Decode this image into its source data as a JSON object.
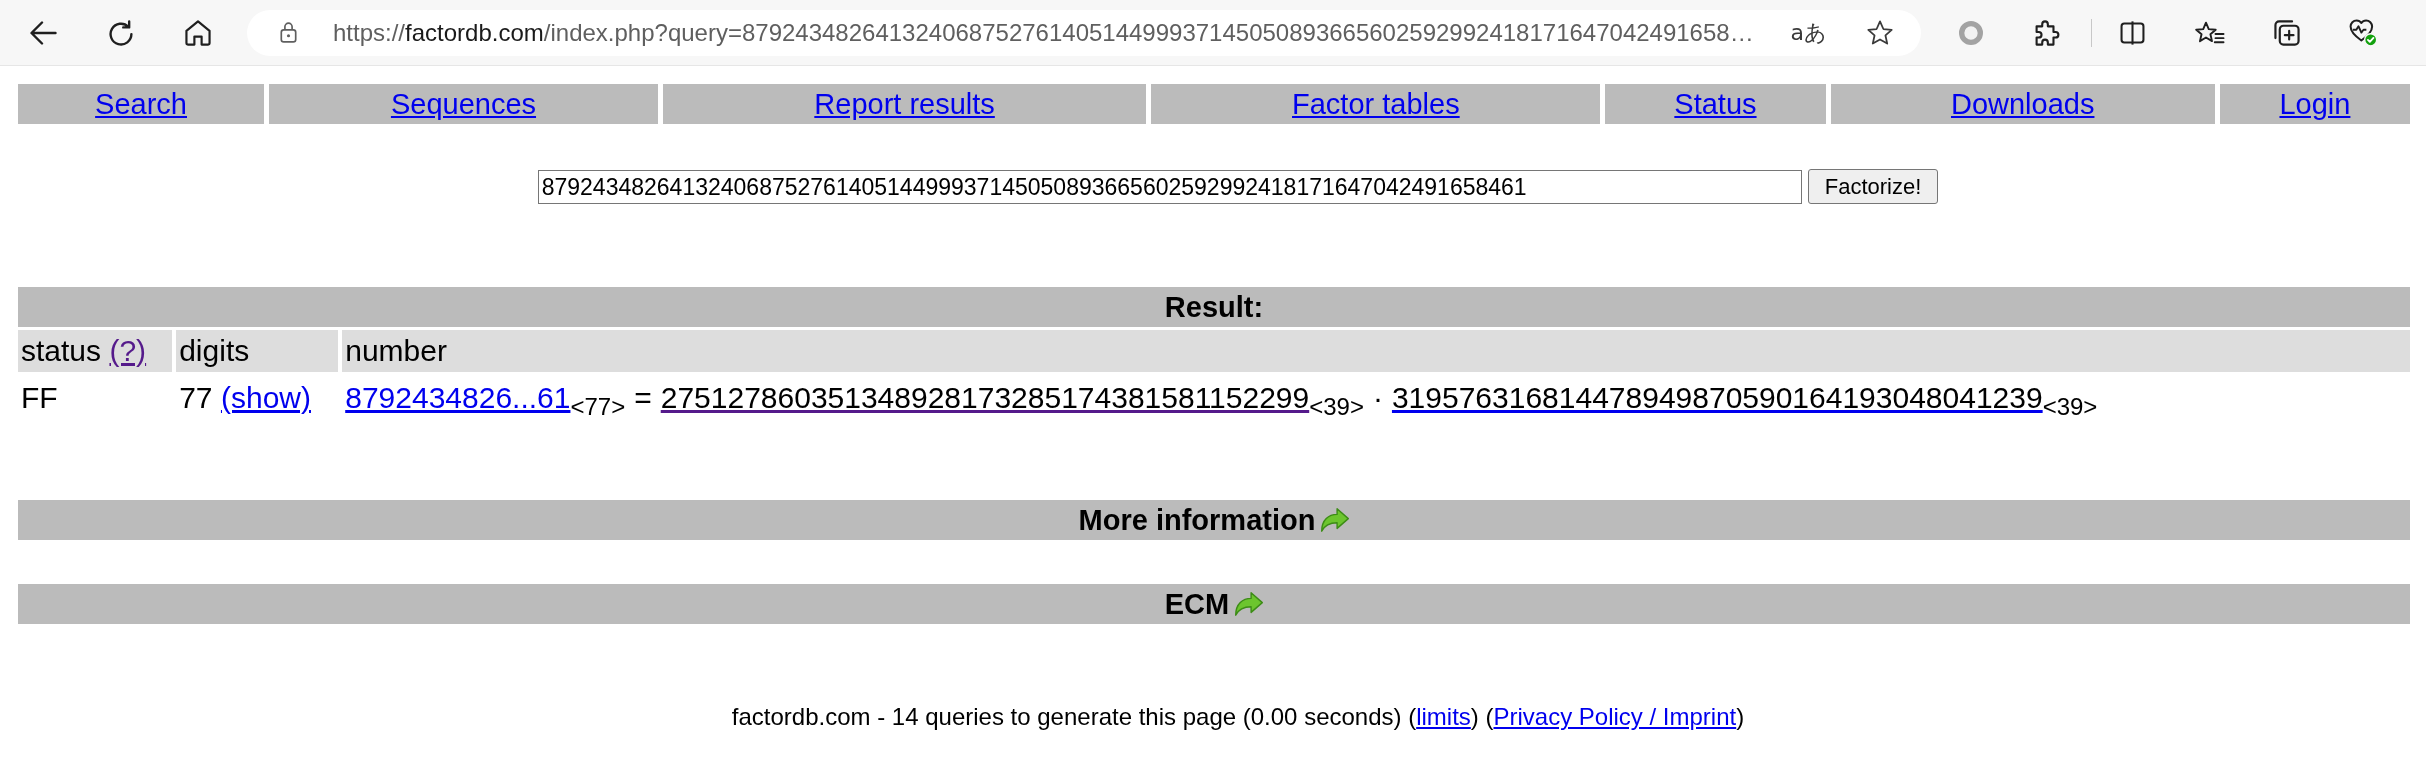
{
  "browser": {
    "url": {
      "scheme": "https://",
      "host": "factordb.com",
      "path": "/index.php?query=87924348264132406875276140514499937145050893665602592992418171647042491658…"
    },
    "reader_label": "aあ"
  },
  "nav": [
    {
      "label": "Search",
      "visited": false
    },
    {
      "label": "Sequences",
      "visited": false
    },
    {
      "label": "Report results",
      "visited": false
    },
    {
      "label": "Factor tables",
      "visited": false
    },
    {
      "label": "Status",
      "visited": false
    },
    {
      "label": "Downloads",
      "visited": false
    },
    {
      "label": "Login",
      "visited": false
    }
  ],
  "search": {
    "value": "87924348264132406875276140514499937145050893665602592992418171647042491658461",
    "button": "Factorize!"
  },
  "result": {
    "title": "Result:",
    "columns": [
      {
        "label": "status",
        "link": {
          "text": "(?)",
          "visited": true
        }
      },
      {
        "label": "digits"
      },
      {
        "label": "number"
      }
    ],
    "rows": [
      {
        "status": "FF",
        "digits": "77",
        "show_link": {
          "text": "(show)",
          "visited": false
        },
        "number": {
          "text": "8792434826...61",
          "size": "<77>",
          "visited": false
        },
        "equals": "=",
        "factors": [
          {
            "text": "275127860351348928173285174381581152299",
            "size": "<39>",
            "visited": true
          },
          {
            "text": "319576316814478949870590164193048041239",
            "size": "<39>",
            "visited": false
          }
        ],
        "separator": "·"
      }
    ]
  },
  "sections": [
    {
      "title": "More information"
    },
    {
      "title": "ECM"
    }
  ],
  "footer": [
    {
      "kind": "text",
      "text": "factordb.com - 14 queries to generate this page (0.00 seconds) ("
    },
    {
      "kind": "link",
      "text": "limits",
      "visited": false
    },
    {
      "kind": "text",
      "text": ") ("
    },
    {
      "kind": "link",
      "text": "Privacy Policy / Imprint",
      "visited": false
    },
    {
      "kind": "text",
      "text": ")"
    }
  ]
}
